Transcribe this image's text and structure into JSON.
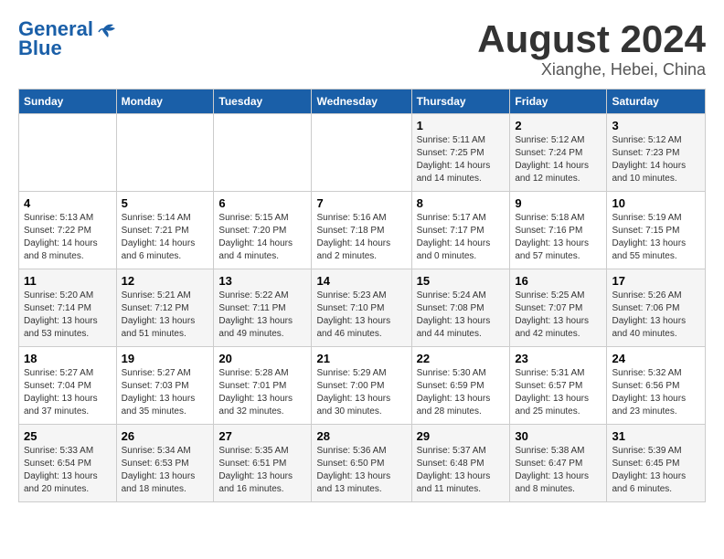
{
  "logo": {
    "line1": "General",
    "line2": "Blue"
  },
  "title": "August 2024",
  "location": "Xianghe, Hebei, China",
  "weekdays": [
    "Sunday",
    "Monday",
    "Tuesday",
    "Wednesday",
    "Thursday",
    "Friday",
    "Saturday"
  ],
  "weeks": [
    [
      {
        "day": "",
        "info": ""
      },
      {
        "day": "",
        "info": ""
      },
      {
        "day": "",
        "info": ""
      },
      {
        "day": "",
        "info": ""
      },
      {
        "day": "1",
        "info": "Sunrise: 5:11 AM\nSunset: 7:25 PM\nDaylight: 14 hours\nand 14 minutes."
      },
      {
        "day": "2",
        "info": "Sunrise: 5:12 AM\nSunset: 7:24 PM\nDaylight: 14 hours\nand 12 minutes."
      },
      {
        "day": "3",
        "info": "Sunrise: 5:12 AM\nSunset: 7:23 PM\nDaylight: 14 hours\nand 10 minutes."
      }
    ],
    [
      {
        "day": "4",
        "info": "Sunrise: 5:13 AM\nSunset: 7:22 PM\nDaylight: 14 hours\nand 8 minutes."
      },
      {
        "day": "5",
        "info": "Sunrise: 5:14 AM\nSunset: 7:21 PM\nDaylight: 14 hours\nand 6 minutes."
      },
      {
        "day": "6",
        "info": "Sunrise: 5:15 AM\nSunset: 7:20 PM\nDaylight: 14 hours\nand 4 minutes."
      },
      {
        "day": "7",
        "info": "Sunrise: 5:16 AM\nSunset: 7:18 PM\nDaylight: 14 hours\nand 2 minutes."
      },
      {
        "day": "8",
        "info": "Sunrise: 5:17 AM\nSunset: 7:17 PM\nDaylight: 14 hours\nand 0 minutes."
      },
      {
        "day": "9",
        "info": "Sunrise: 5:18 AM\nSunset: 7:16 PM\nDaylight: 13 hours\nand 57 minutes."
      },
      {
        "day": "10",
        "info": "Sunrise: 5:19 AM\nSunset: 7:15 PM\nDaylight: 13 hours\nand 55 minutes."
      }
    ],
    [
      {
        "day": "11",
        "info": "Sunrise: 5:20 AM\nSunset: 7:14 PM\nDaylight: 13 hours\nand 53 minutes."
      },
      {
        "day": "12",
        "info": "Sunrise: 5:21 AM\nSunset: 7:12 PM\nDaylight: 13 hours\nand 51 minutes."
      },
      {
        "day": "13",
        "info": "Sunrise: 5:22 AM\nSunset: 7:11 PM\nDaylight: 13 hours\nand 49 minutes."
      },
      {
        "day": "14",
        "info": "Sunrise: 5:23 AM\nSunset: 7:10 PM\nDaylight: 13 hours\nand 46 minutes."
      },
      {
        "day": "15",
        "info": "Sunrise: 5:24 AM\nSunset: 7:08 PM\nDaylight: 13 hours\nand 44 minutes."
      },
      {
        "day": "16",
        "info": "Sunrise: 5:25 AM\nSunset: 7:07 PM\nDaylight: 13 hours\nand 42 minutes."
      },
      {
        "day": "17",
        "info": "Sunrise: 5:26 AM\nSunset: 7:06 PM\nDaylight: 13 hours\nand 40 minutes."
      }
    ],
    [
      {
        "day": "18",
        "info": "Sunrise: 5:27 AM\nSunset: 7:04 PM\nDaylight: 13 hours\nand 37 minutes."
      },
      {
        "day": "19",
        "info": "Sunrise: 5:27 AM\nSunset: 7:03 PM\nDaylight: 13 hours\nand 35 minutes."
      },
      {
        "day": "20",
        "info": "Sunrise: 5:28 AM\nSunset: 7:01 PM\nDaylight: 13 hours\nand 32 minutes."
      },
      {
        "day": "21",
        "info": "Sunrise: 5:29 AM\nSunset: 7:00 PM\nDaylight: 13 hours\nand 30 minutes."
      },
      {
        "day": "22",
        "info": "Sunrise: 5:30 AM\nSunset: 6:59 PM\nDaylight: 13 hours\nand 28 minutes."
      },
      {
        "day": "23",
        "info": "Sunrise: 5:31 AM\nSunset: 6:57 PM\nDaylight: 13 hours\nand 25 minutes."
      },
      {
        "day": "24",
        "info": "Sunrise: 5:32 AM\nSunset: 6:56 PM\nDaylight: 13 hours\nand 23 minutes."
      }
    ],
    [
      {
        "day": "25",
        "info": "Sunrise: 5:33 AM\nSunset: 6:54 PM\nDaylight: 13 hours\nand 20 minutes."
      },
      {
        "day": "26",
        "info": "Sunrise: 5:34 AM\nSunset: 6:53 PM\nDaylight: 13 hours\nand 18 minutes."
      },
      {
        "day": "27",
        "info": "Sunrise: 5:35 AM\nSunset: 6:51 PM\nDaylight: 13 hours\nand 16 minutes."
      },
      {
        "day": "28",
        "info": "Sunrise: 5:36 AM\nSunset: 6:50 PM\nDaylight: 13 hours\nand 13 minutes."
      },
      {
        "day": "29",
        "info": "Sunrise: 5:37 AM\nSunset: 6:48 PM\nDaylight: 13 hours\nand 11 minutes."
      },
      {
        "day": "30",
        "info": "Sunrise: 5:38 AM\nSunset: 6:47 PM\nDaylight: 13 hours\nand 8 minutes."
      },
      {
        "day": "31",
        "info": "Sunrise: 5:39 AM\nSunset: 6:45 PM\nDaylight: 13 hours\nand 6 minutes."
      }
    ]
  ]
}
